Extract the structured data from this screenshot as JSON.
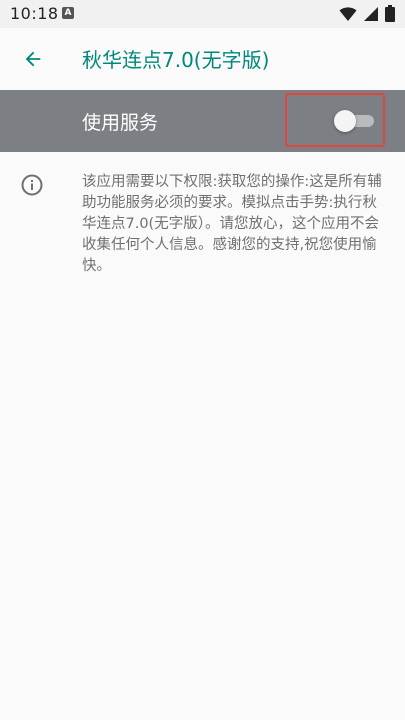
{
  "status_bar": {
    "time": "10:18",
    "notification_icon": "A",
    "icons": [
      "wifi-icon",
      "signal-icon",
      "battery-icon"
    ]
  },
  "app_bar": {
    "title": "秋华连点7.0(无字版)",
    "back_icon": "arrow-back-icon"
  },
  "service": {
    "label": "使用服务",
    "enabled": false
  },
  "info": {
    "icon": "info-icon",
    "text": "该应用需要以下权限:获取您的操作:这是所有辅助功能服务必须的要求。模拟点击手势:执行秋华连点7.0(无字版）。请您放心，这个应用不会收集任何个人信息。感谢您的支持,祝您使用愉快。"
  },
  "colors": {
    "accent": "#00897b",
    "service_row_bg": "#7c7f84",
    "highlight": "#e0463f",
    "text_secondary": "#707070"
  }
}
